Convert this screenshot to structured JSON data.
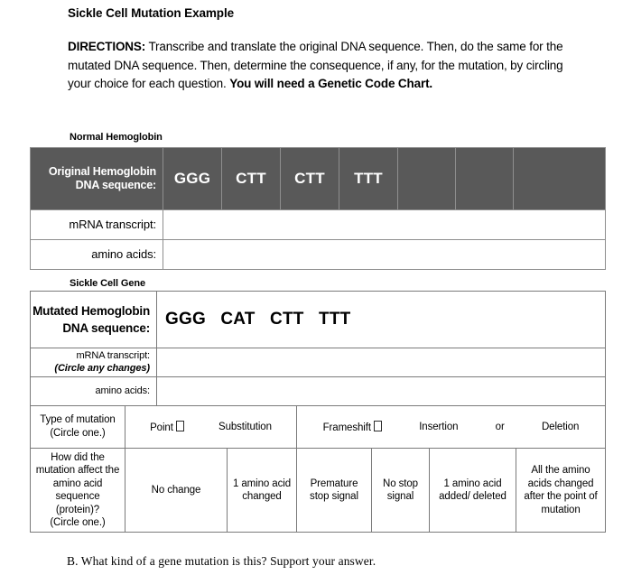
{
  "document": {
    "title": "Sickle Cell Mutation Example",
    "directions_label": "DIRECTIONS:",
    "directions_body": " Transcribe and translate the original DNA sequence. Then, do the same for the mutated DNA sequence. Then, determine the consequence, if any, for the mutation, by circling your choice for each question. ",
    "directions_bold_tail": "You will need a Genetic Code Chart."
  },
  "normal_section": {
    "caption": "Normal Hemoglobin",
    "header_label": "Original Hemoglobin DNA sequence:",
    "codons": [
      "GGG",
      "CTT",
      "CTT",
      "TTT",
      "",
      "",
      ""
    ],
    "rows": [
      {
        "label": "mRNA transcript:",
        "value": ""
      },
      {
        "label": "amino acids:",
        "value": ""
      }
    ],
    "header_bg": "#595959",
    "header_text_color": "#ffffff"
  },
  "sickle_section": {
    "caption": "Sickle Cell Gene",
    "header_label": "Mutated Hemoglobin DNA sequence:",
    "sequence": "GGG   CAT   CTT   TTT",
    "rows": [
      {
        "label": "mRNA transcript:",
        "sublabel": "(Circle any changes)",
        "value": ""
      },
      {
        "label": "amino acids:",
        "sublabel": "",
        "value": ""
      }
    ],
    "mutation_type": {
      "label": "Type of mutation",
      "instruction": "(Circle one.)",
      "group_a": [
        "Point",
        "Substitution"
      ],
      "group_b": [
        "Frameshift",
        "Insertion",
        "or",
        "Deletion"
      ],
      "glyph": "missing-glyph-box"
    },
    "mutation_effect": {
      "label": "How did the mutation affect the amino acid sequence (protein)?",
      "instruction": "(Circle one.)",
      "options": [
        "No change",
        "1 amino acid changed",
        "Premature stop signal",
        "No stop signal",
        "1 amino acid added/ deleted",
        "All the amino acids changed after the point of mutation"
      ]
    }
  },
  "bottom": {
    "question": "B. What kind of a gene mutation is this? Support your answer."
  }
}
